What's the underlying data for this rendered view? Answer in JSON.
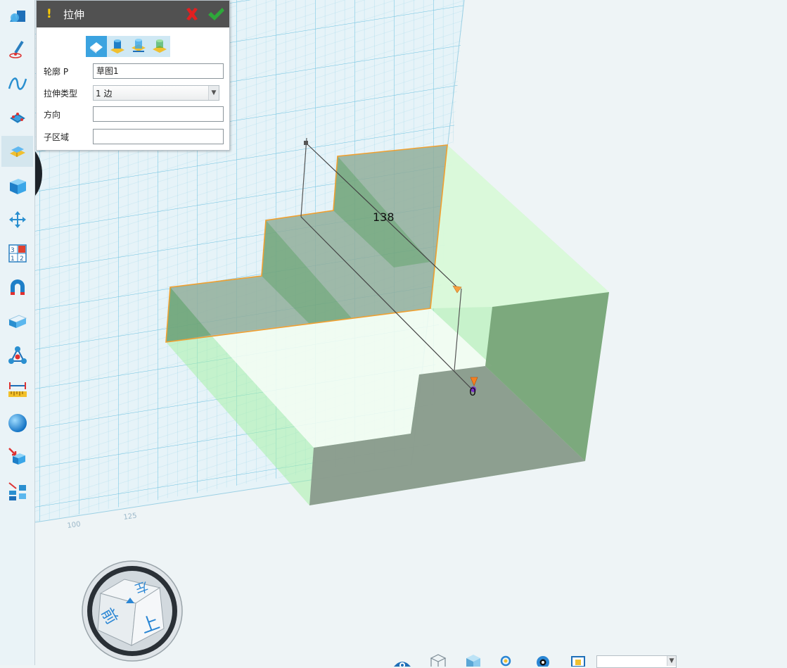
{
  "toolbar": {
    "tools": [
      {
        "name": "basic-shapes-icon"
      },
      {
        "name": "sketch-pen-icon"
      },
      {
        "name": "curve-icon"
      },
      {
        "name": "feature-edit-icon"
      },
      {
        "name": "extrude-feature-icon"
      },
      {
        "name": "solid-box-icon"
      },
      {
        "name": "move-arrows-icon"
      },
      {
        "name": "array-grid-icon"
      },
      {
        "name": "magnet-icon"
      },
      {
        "name": "block-icon"
      },
      {
        "name": "combine-nodes-icon"
      },
      {
        "name": "measure-ruler-icon"
      },
      {
        "name": "sphere-material-icon"
      },
      {
        "name": "insert-part-icon"
      },
      {
        "name": "layout-tools-icon"
      }
    ]
  },
  "panel": {
    "title": "拉伸",
    "warning_symbol": "!",
    "fields": {
      "profile_label": "轮廓 P",
      "profile_value": "草图1",
      "type_label": "拉伸类型",
      "type_value": "1 边",
      "direction_label": "方向",
      "direction_value": "",
      "subregion_label": "子区域",
      "subregion_value": ""
    }
  },
  "viewport": {
    "dimension_value": "138",
    "handle_value": "0",
    "ruler_labels": [
      "100",
      "125"
    ]
  },
  "view_cube": {
    "top_face": "上",
    "left_face": "前",
    "right_face": "左"
  },
  "colors": {
    "accent_blue": "#3ba3e0",
    "header_dark": "#515151",
    "cancel_red": "#e02020",
    "ok_green": "#2ea83a",
    "grid_line": "#7fcbe3",
    "extrude_green": "#9ff0a0",
    "solid_gray": "#8a9a8c",
    "handle_orange": "#f5a040"
  }
}
